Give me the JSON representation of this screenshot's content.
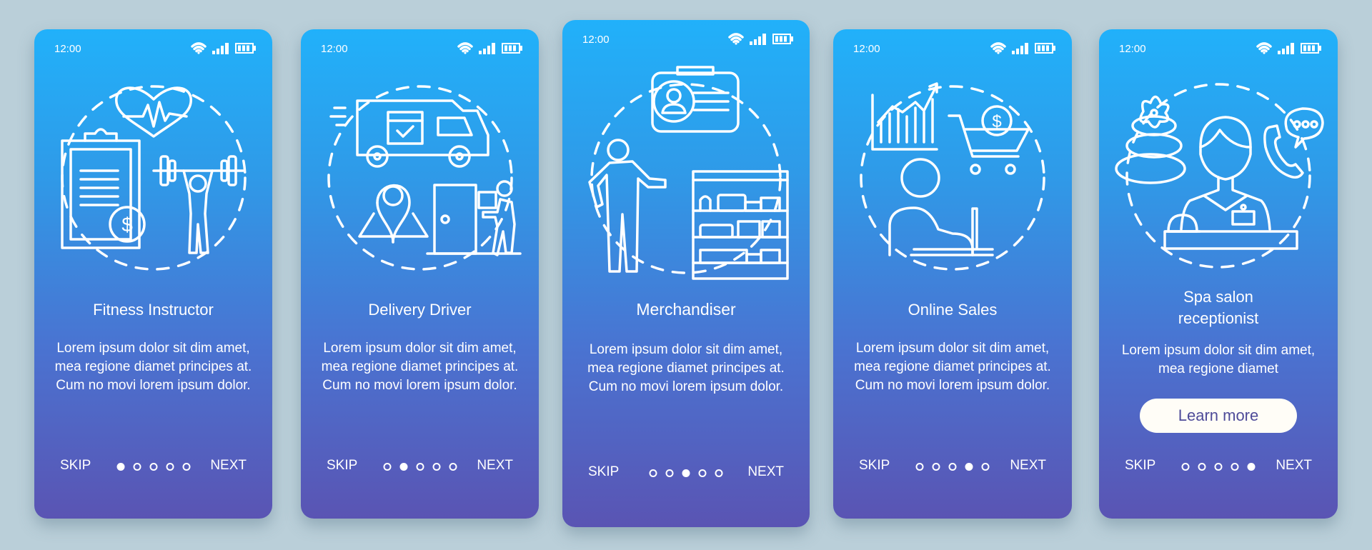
{
  "status_bar": {
    "time": "12:00",
    "icons": [
      "wifi-icon",
      "signal-icon",
      "battery-icon"
    ]
  },
  "colors": {
    "background": "#bacfd9",
    "gradient_top": "#21b1fa",
    "gradient_bottom": "#5a54b3",
    "button_bg": "#fffdf7",
    "button_text": "#4e4b99"
  },
  "nav": {
    "skip_label": "SKIP",
    "next_label": "NEXT",
    "total_pages": 5
  },
  "cards": [
    {
      "title": "Fitness Instructor",
      "illustration": "fitness-illustration",
      "description": "Lorem ipsum dolor sit dim amet, mea regione diamet principes at. Cum no movi lorem ipsum dolor.",
      "active_page": 1
    },
    {
      "title": "Delivery Driver",
      "illustration": "delivery-illustration",
      "description": "Lorem ipsum dolor sit dim amet, mea regione diamet principes at. Cum no movi lorem ipsum dolor.",
      "active_page": 2
    },
    {
      "title": "Merchandiser",
      "illustration": "merchandiser-illustration",
      "description": "Lorem ipsum dolor sit dim amet, mea regione diamet principes at. Cum no movi lorem ipsum dolor.",
      "active_page": 3
    },
    {
      "title": "Online Sales",
      "illustration": "online-sales-illustration",
      "description": "Lorem ipsum dolor sit dim amet, mea regione diamet principes at. Cum no movi lorem ipsum dolor.",
      "active_page": 4
    },
    {
      "title": "Spa salon receptionist",
      "illustration": "spa-receptionist-illustration",
      "description": "Lorem ipsum dolor sit dim amet, mea regione diamet",
      "button_label": "Learn more",
      "active_page": 5
    }
  ]
}
